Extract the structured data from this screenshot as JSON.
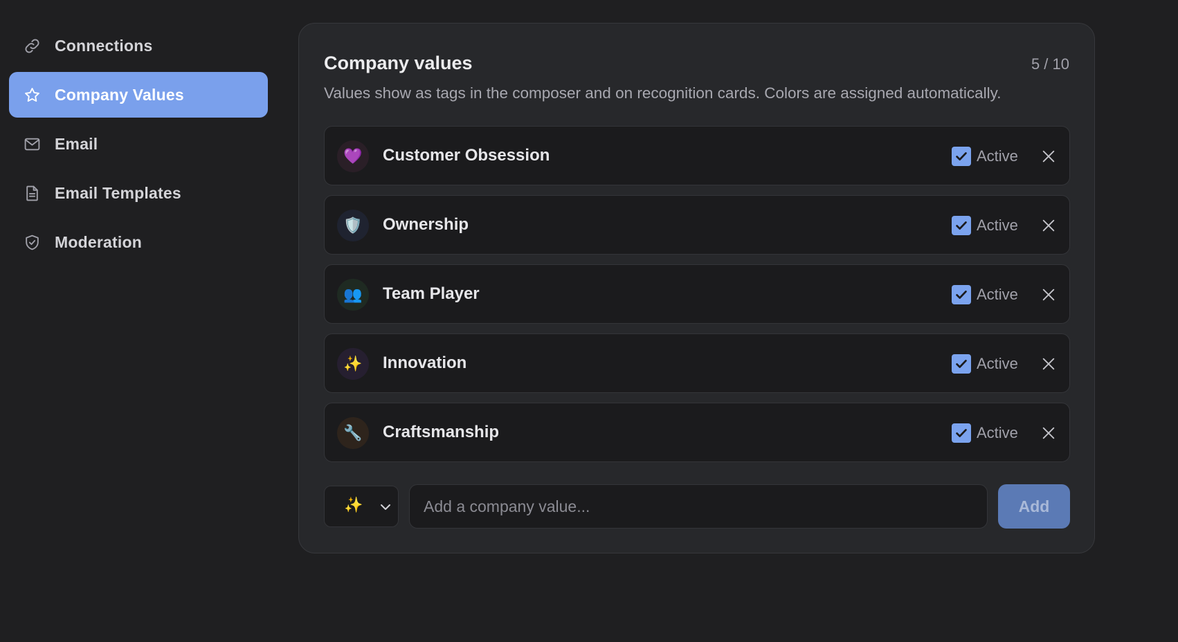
{
  "sidebar": {
    "items": [
      {
        "label": "Connections",
        "icon": "link-icon",
        "active": false
      },
      {
        "label": "Company Values",
        "icon": "star-icon",
        "active": true
      },
      {
        "label": "Email",
        "icon": "mail-icon",
        "active": false
      },
      {
        "label": "Email Templates",
        "icon": "document-icon",
        "active": false
      },
      {
        "label": "Moderation",
        "icon": "shield-check-icon",
        "active": false
      }
    ]
  },
  "card": {
    "title": "Company values",
    "count": "5 / 10",
    "description": "Values show as tags in the composer and on recognition cards. Colors are assigned automatically."
  },
  "values": [
    {
      "emoji": "💜",
      "name": "Customer Obsession",
      "active": true,
      "active_label": "Active",
      "badge_color": "#2a1f27"
    },
    {
      "emoji": "🛡️",
      "name": "Ownership",
      "active": true,
      "active_label": "Active",
      "badge_color": "#1f2330"
    },
    {
      "emoji": "👥",
      "name": "Team Player",
      "active": true,
      "active_label": "Active",
      "badge_color": "#1f2a22"
    },
    {
      "emoji": "✨",
      "name": "Innovation",
      "active": true,
      "active_label": "Active",
      "badge_color": "#261f30"
    },
    {
      "emoji": "🔧",
      "name": "Craftsmanship",
      "active": true,
      "active_label": "Active",
      "badge_color": "#2e241c"
    }
  ],
  "add_form": {
    "selected_emoji": "✨",
    "placeholder": "Add a company value...",
    "value": "",
    "add_label": "Add"
  },
  "colors": {
    "accent": "#7aa0ec",
    "checkbox": "#7ba3ee",
    "add_button": "#5b7ab5",
    "background": "#1f1f21",
    "card": "#27282b"
  }
}
